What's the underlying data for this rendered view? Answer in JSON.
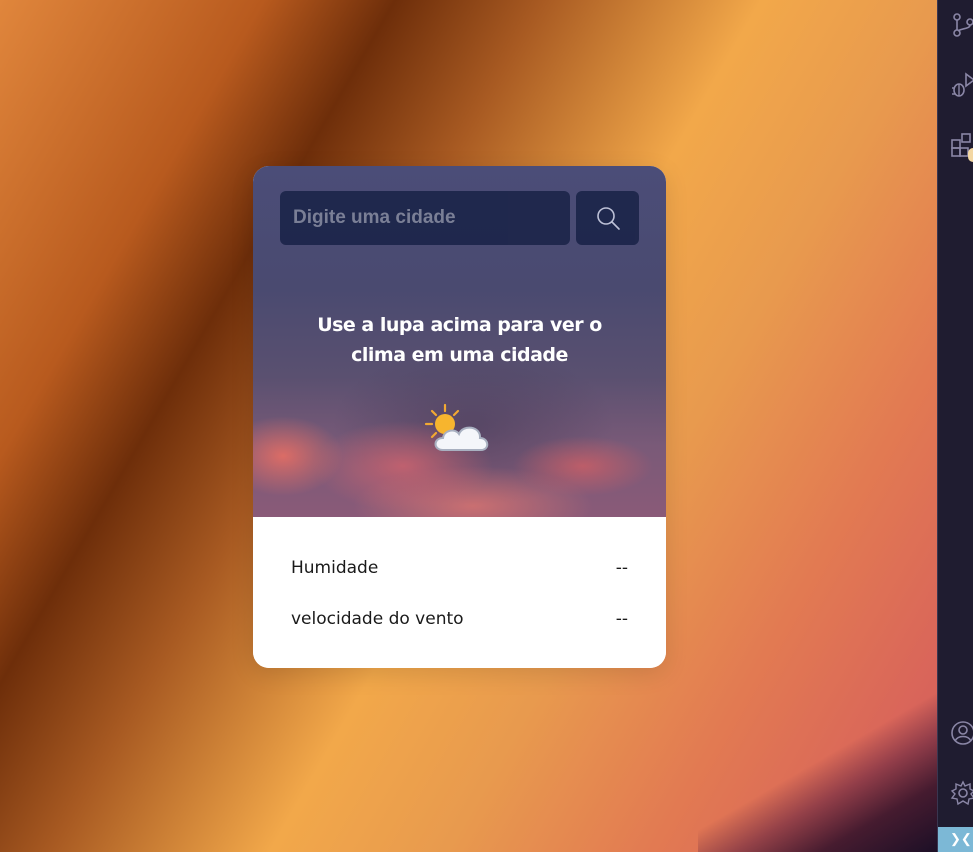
{
  "search": {
    "placeholder": "Digite uma cidade",
    "button_icon": "search-icon"
  },
  "weather": {
    "message": "Use a lupa acima para ver o clima em uma cidade",
    "icon": "partly-sunny-icon"
  },
  "details": [
    {
      "label": "Humidade",
      "value": "--"
    },
    {
      "label": "velocidade do vento",
      "value": "--"
    }
  ],
  "activity_bar": {
    "icons": [
      "source-control-icon",
      "run-debug-icon",
      "extensions-icon",
      "account-icon",
      "settings-icon"
    ],
    "status_icon": "remote-icon"
  },
  "colors": {
    "card_input_bg": "#1c254a",
    "card_bottom_bg": "#ffffff",
    "activity_bar_bg": "#1f1c30",
    "status_strip": "#7cb8d6"
  }
}
